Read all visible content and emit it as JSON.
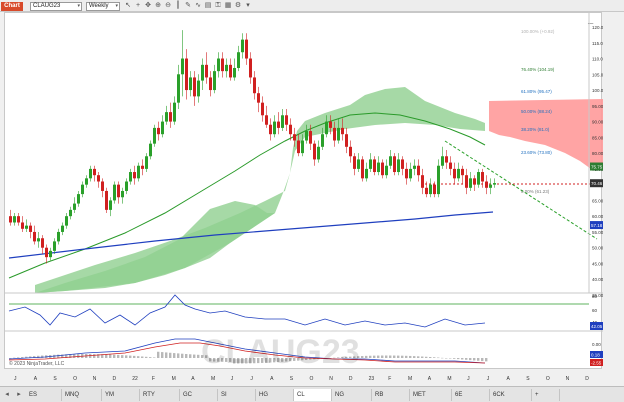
{
  "toolbar": {
    "chart_tab": "Chart",
    "symbol": "CLAUG23",
    "interval": "Weekly",
    "icons": [
      "cursor-icon",
      "crosshair-icon",
      "pan-icon",
      "zoom-in-icon",
      "zoom-out-icon",
      "bar-style-icon",
      "draw-icon",
      "indicator-icon",
      "template-icon",
      "lock-icon",
      "tiles-icon",
      "properties-icon",
      "more-icon"
    ]
  },
  "price_axis": {
    "ticks": [
      "120.00",
      "115.00",
      "110.00",
      "105.00",
      "100.00",
      "95.00",
      "90.00",
      "85.00",
      "80.00",
      "75.00",
      "70.00",
      "65.00",
      "60.00",
      "55.00",
      "50.00",
      "45.00",
      "40.00",
      "35.00"
    ],
    "flags": [
      {
        "label": "75.75",
        "color": "#2e7d32"
      },
      {
        "label": "70.46",
        "color": "#333333"
      },
      {
        "label": "57.18",
        "color": "#1f3fbf"
      }
    ]
  },
  "fib_labels": [
    {
      "text": "100.00% (+0.92)",
      "color": "#b0b0b0"
    },
    {
      "text": "76.40% (104.19)",
      "color": "#2e7d32"
    },
    {
      "text": "61.80% (95.47)",
      "color": "#1f6fbf"
    },
    {
      "text": "50.00% (88.24)",
      "color": "#1f6fbf"
    },
    {
      "text": "38.20% (81.0)",
      "color": "#1f6fbf"
    },
    {
      "text": "23.60% (73.80)",
      "color": "#1f6fbf"
    },
    {
      "text": "0.00% (61.23)",
      "color": "#777777"
    }
  ],
  "indicator1": {
    "ticks": [
      "80",
      "60",
      "40"
    ],
    "flag": "42.05"
  },
  "indicator2": {
    "ticks": [
      "0.00",
      "-5.00"
    ],
    "flags": [
      "0.18",
      "-2.55"
    ]
  },
  "watermark": "CLAUG23",
  "copyright": "© 2023 NinjaTrader, LLC",
  "time_axis": [
    "J",
    "A",
    "S",
    "O",
    "N",
    "D",
    "22",
    "F",
    "M",
    "A",
    "M",
    "J",
    "J",
    "A",
    "S",
    "O",
    "N",
    "D",
    "23",
    "F",
    "M",
    "A",
    "M",
    "J",
    "J",
    "A",
    "S",
    "O",
    "N",
    "D"
  ],
  "bottom_tabs": [
    "ES",
    "MNQ",
    "YM",
    "RTY",
    "GC",
    "SI",
    "HG",
    "CL",
    "NG",
    "RB",
    "MET",
    "6E",
    "6CK",
    "+"
  ],
  "active_tab": "CL",
  "colors": {
    "cloud": "#90d090",
    "cloud_red": "#ff9a9a",
    "sma_green": "#2a9a2a",
    "sma_blue": "#1f3fbf",
    "candle_up": "#2aa02a",
    "candle_down": "#d02020",
    "trendline": "#2aa02a",
    "support": "#d02020"
  },
  "chart_data": {
    "type": "candlestick",
    "x": [
      "2021-07",
      "2021-08",
      "2021-09",
      "2021-10",
      "2021-11",
      "2021-12",
      "2022-01",
      "2022-02",
      "2022-03",
      "2022-04",
      "2022-05",
      "2022-06",
      "2022-07",
      "2022-08",
      "2022-09",
      "2022-10",
      "2022-11",
      "2022-12",
      "2023-01",
      "2023-02",
      "2023-03",
      "2023-04",
      "2023-05",
      "2023-06",
      "2023-07"
    ],
    "close": [
      60,
      48,
      62,
      72,
      58,
      67,
      76,
      90,
      107,
      100,
      108,
      104,
      90,
      87,
      80,
      84,
      81,
      74,
      76,
      75,
      69,
      78,
      71,
      69,
      70.46
    ],
    "ylim": [
      34,
      121
    ],
    "annotations": [
      "descending trendline",
      "support line ~67"
    ]
  }
}
